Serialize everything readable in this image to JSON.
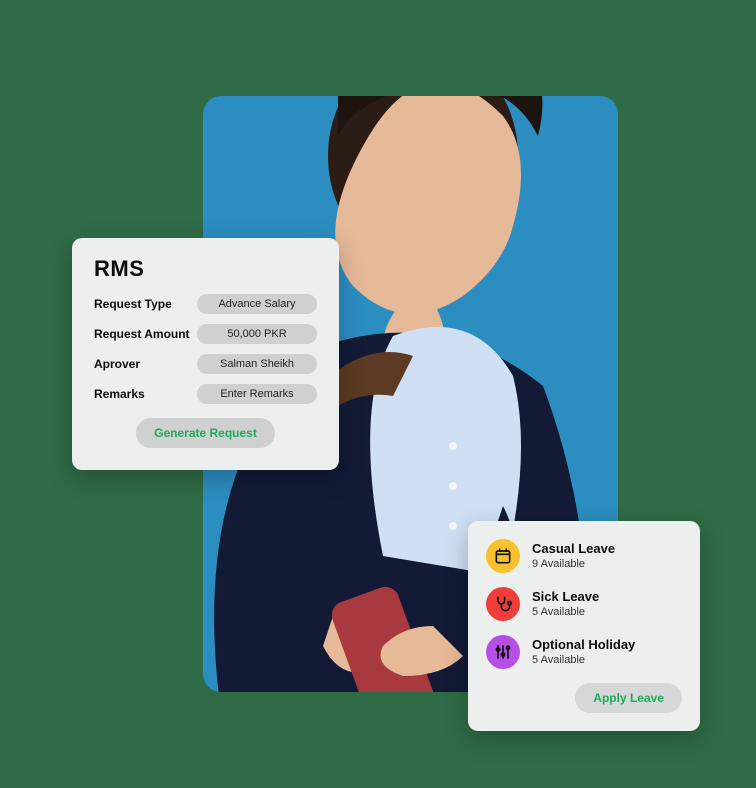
{
  "rms": {
    "title": "RMS",
    "rows": [
      {
        "label": "Request Type",
        "value": "Advance Salary"
      },
      {
        "label": "Request Amount",
        "value": "50,000 PKR"
      },
      {
        "label": "Aprover",
        "value": "Salman Sheikh"
      },
      {
        "label": "Remarks",
        "value": "Enter Remarks"
      }
    ],
    "generate_label": "Generate Request"
  },
  "leave": {
    "items": [
      {
        "name": "Casual Leave",
        "available": "9 Available"
      },
      {
        "name": "Sick Leave",
        "available": "5 Available"
      },
      {
        "name": "Optional Holiday",
        "available": "5 Available"
      }
    ],
    "apply_label": "Apply Leave"
  }
}
